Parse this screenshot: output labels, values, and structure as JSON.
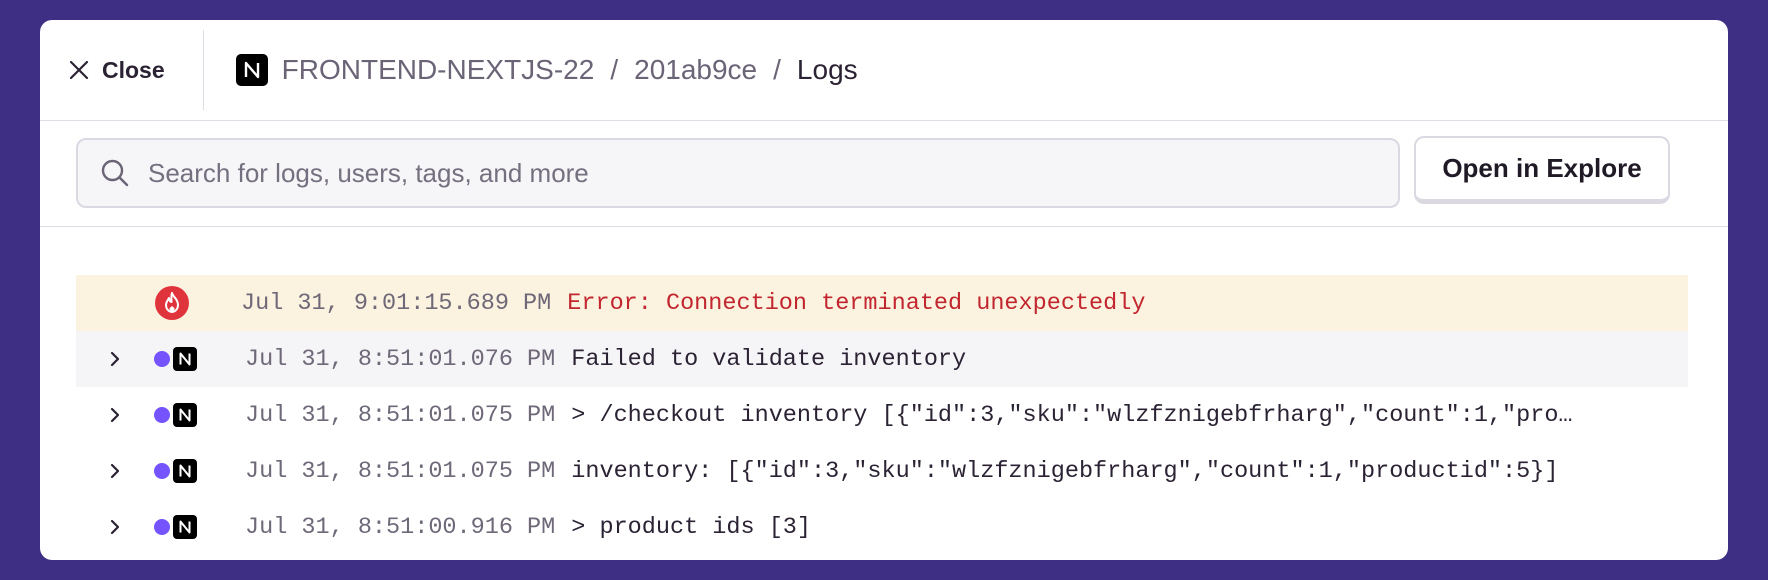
{
  "header": {
    "close_label": "Close",
    "breadcrumbs": {
      "project": "FRONTEND-NEXTJS-22",
      "id": "201ab9ce",
      "current": "Logs",
      "separator": "/"
    }
  },
  "toolbar": {
    "search_placeholder": "Search for logs, users, tags, and more",
    "search_value": "",
    "explore_label": "Open in Explore"
  },
  "logs": [
    {
      "level": "error",
      "timestamp": "Jul 31, 9:01:15.689 PM",
      "message": "Error: Connection terminated unexpectedly"
    },
    {
      "level": "info",
      "timestamp": "Jul 31, 8:51:01.076 PM",
      "message": "Failed to validate inventory"
    },
    {
      "level": "info",
      "timestamp": "Jul 31, 8:51:01.075 PM",
      "message": "> /checkout inventory [{\"id\":3,\"sku\":\"wlzfznigebfrharg\",\"count\":1,\"pro…"
    },
    {
      "level": "info",
      "timestamp": "Jul 31, 8:51:01.075 PM",
      "message": "inventory: [{\"id\":3,\"sku\":\"wlzfznigebfrharg\",\"count\":1,\"productid\":5}]"
    },
    {
      "level": "info",
      "timestamp": "Jul 31, 8:51:00.916 PM",
      "message": "> product ids [3]"
    }
  ],
  "colors": {
    "background": "#3e2f84",
    "error_text": "#c2262f",
    "error_row": "#fbf2df",
    "info_dot": "#7553ff",
    "error_badge": "#e0343d"
  },
  "icons": {
    "close": "close-icon",
    "platform": "nextjs-icon",
    "search": "search-icon",
    "expand": "chevron-right-icon",
    "error": "fire-icon"
  }
}
